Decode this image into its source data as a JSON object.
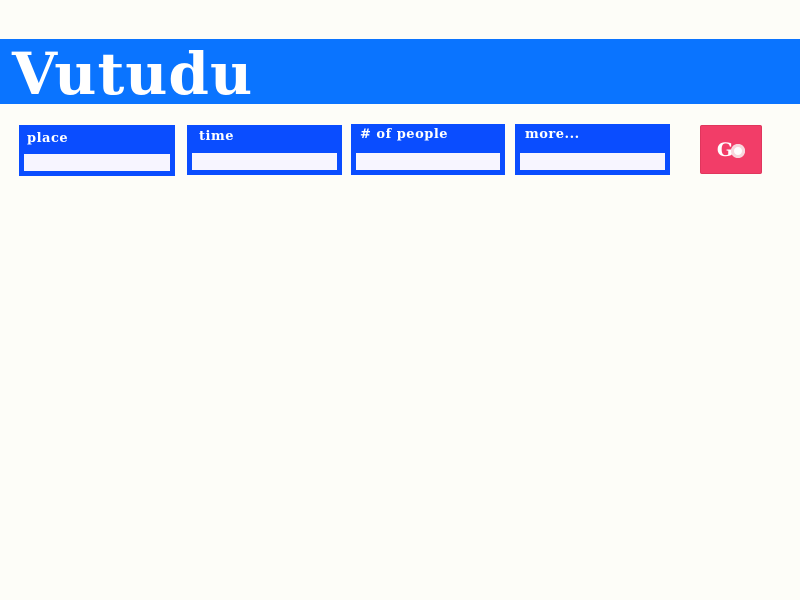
{
  "header": {
    "logo": "Vutudu"
  },
  "search": {
    "fields": [
      {
        "label": "place",
        "value": "",
        "placeholder": ""
      },
      {
        "label": "time",
        "value": "",
        "placeholder": ""
      },
      {
        "label": "# of people",
        "value": "",
        "placeholder": ""
      },
      {
        "label": "more...",
        "value": "",
        "placeholder": ""
      }
    ],
    "go_label": "G",
    "go_icon": "circle-icon"
  },
  "colors": {
    "background": "#fdfdf8",
    "header": "#0a74ff",
    "field": "#0a4dff",
    "go_button": "#f23d68"
  }
}
